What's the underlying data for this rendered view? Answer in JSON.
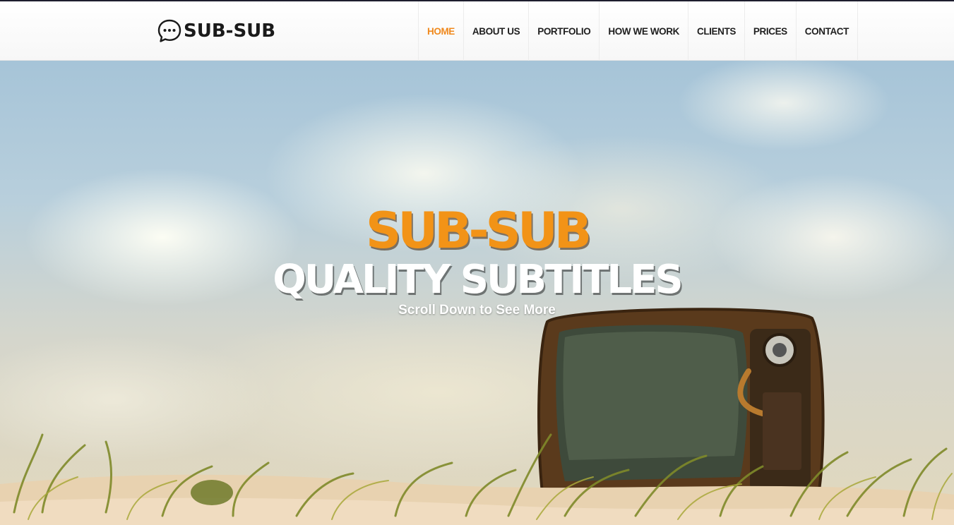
{
  "brand": {
    "name": "SUB-SUB",
    "icon": "speech-bubble-icon"
  },
  "nav": {
    "items": [
      {
        "label": "HOME",
        "active": true
      },
      {
        "label": "ABOUT US",
        "active": false
      },
      {
        "label": "PORTFOLIO",
        "active": false
      },
      {
        "label": "HOW WE WORK",
        "active": false
      },
      {
        "label": "CLIENTS",
        "active": false
      },
      {
        "label": "PRICES",
        "active": false
      },
      {
        "label": "CONTACT",
        "active": false
      }
    ]
  },
  "hero": {
    "title": "SUB-SUB",
    "subtitle": "QUALITY SUBTITLES",
    "scroll_text": "Scroll Down to See More"
  },
  "colors": {
    "accent": "#f0891d",
    "nav_text": "#1f1f1f",
    "header_top_line": "#1d1d2e"
  }
}
